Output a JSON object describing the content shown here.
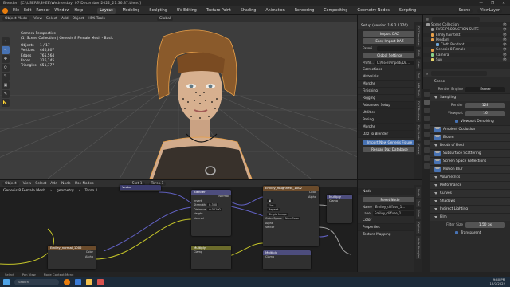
{
  "window": {
    "title": "Blender* [C:\\USERS\\SHEE\\Wednesday, 07-December-2022_21.36.37.blend]",
    "controls": [
      "—",
      "❐",
      "✕"
    ]
  },
  "menubar": {
    "menus": [
      "File",
      "Edit",
      "Render",
      "Window",
      "Help"
    ],
    "workspaces": [
      "Layout",
      "Modeling",
      "Sculpting",
      "UV Editing",
      "Texture Paint",
      "Shading",
      "Animation",
      "Rendering",
      "Compositing",
      "Geometry Nodes",
      "Scripting"
    ],
    "active_workspace": "Layout",
    "scene": "Scene",
    "view_layer": "ViewLayer"
  },
  "viewport": {
    "mode": "Object Mode",
    "menus": [
      "View",
      "Select",
      "Add",
      "Object"
    ],
    "extra": "HPK Tools",
    "orientation": "Global",
    "overlay": {
      "title": "Camera Perspective",
      "collection": "(1) Scene Collection | Genesis 8 Female Mesh - Basic",
      "stats": [
        {
          "label": "Objects",
          "value": "1 / 17"
        },
        {
          "label": "Vertices",
          "value": "440,807"
        },
        {
          "label": "Edges",
          "value": "765,564"
        },
        {
          "label": "Faces",
          "value": "326,145"
        },
        {
          "label": "Triangles",
          "value": "651,777"
        }
      ]
    },
    "tools": [
      "⌖",
      "↖",
      "✥",
      "⟳",
      "⤡",
      "▣",
      "✎",
      "📐"
    ]
  },
  "plugin_panel": {
    "header": "Setup (version 1.6.2.1276)",
    "buttons": [
      "Import DAZ",
      "Easy Import DAZ"
    ],
    "favorites_label": "Favori...",
    "global_settings": "Global Settings",
    "profile_label": "Profil...",
    "profile_path": "C:/Users/mpedi/Do...",
    "sections": [
      "Corrections",
      "Materials",
      "Morphs",
      "Finishing",
      "Rigging"
    ],
    "lower_sections": [
      "Advanced Setup",
      "Utilities",
      "Posing",
      "Morphs",
      "Daz To Blender"
    ],
    "new_genesis_button": "Import New Genesis Figure",
    "scan_button": "Rescan Daz Database",
    "tabs": [
      "DAZ Importer",
      "Edit",
      "View",
      "Tool",
      "HPK Tools",
      "DAZ Runtime",
      "Flip Fluids",
      "Create",
      "Daz Tools",
      "Cam Pose"
    ]
  },
  "outliner": {
    "items": [
      {
        "name": "Scene Collection",
        "indent": 0,
        "color": "#9a9a9a"
      },
      {
        "name": "EVEE PRODUCTION SUITE",
        "indent": 1,
        "color": "#9a9a9a"
      },
      {
        "name": "Emily hair test",
        "indent": 1,
        "color": "#e8a04a"
      },
      {
        "name": "Pendant",
        "indent": 1,
        "color": "#e8a04a"
      },
      {
        "name": "Cloth Pendant",
        "indent": 2,
        "color": "#6fa6d8"
      },
      {
        "name": "Genesis 8 Female",
        "indent": 1,
        "color": "#e8a04a"
      },
      {
        "name": "Camera",
        "indent": 1,
        "color": "#8ad18a"
      },
      {
        "name": "Sun",
        "indent": 1,
        "color": "#e6d46b"
      }
    ]
  },
  "properties": {
    "scene": "Scene",
    "render_engine_label": "Render Engine",
    "render_engine": "Eevee",
    "sampling": "Sampling",
    "render_label": "Render",
    "render_samples": "128",
    "viewport_label": "Viewport",
    "viewport_samples": "16",
    "denoise": "Viewport Denoising",
    "toggles": [
      "Ambient Occlusion",
      "Bloom",
      "Depth of Field",
      "Subsurface Scattering",
      "Screen Space Reflections",
      "Motion Blur",
      "Volumetrics",
      "Performance",
      "Curves",
      "Shadows",
      "Indirect Lighting",
      "Film"
    ],
    "filter_size_label": "Filter Size",
    "filter_size": "1.50 px",
    "transparent": "Transparent"
  },
  "node_editor": {
    "type": "Object",
    "menus": [
      "View",
      "Select",
      "Add",
      "Node"
    ],
    "use_nodes": "Use Nodes",
    "slot": "Slot 1",
    "material": "Torso.1",
    "breadcrumb": [
      "Genesis 8 Female Mesh",
      "geometry",
      "Torso.1"
    ],
    "nodes": {
      "vector": "Vector",
      "blender": "Blender",
      "normal": "Normal",
      "invert": "Invert",
      "strength": "Strength",
      "strength_val": "0.300",
      "distance": "Distance",
      "distance_val": "0.00100",
      "height": "Height",
      "roughness_tex": "Emiley_roughness_1002",
      "color": "Color",
      "alpha": "Alpha",
      "flat": "Flat",
      "repeat": "Repeat",
      "single_image": "Single Image",
      "color_space": "Color Space",
      "non_color": "Non-Color",
      "alpha_label": "Alpha",
      "normal_tex": "Emiley_normal_1002",
      "multiply_label": "Multiply",
      "clamp_label": "Clamp"
    }
  },
  "node_panel": {
    "section": "Node",
    "name_label": "Name",
    "name": "Emiley_diffuse_1...",
    "label_label": "Label",
    "label": "Emiley_diffuse_1...",
    "reset": "Reset Node",
    "color": "Color",
    "properties": "Properties",
    "texture_mapping": "Texture Mapping",
    "tabs": [
      "Node",
      "Tool",
      "View",
      "Options",
      "Node Wrangler"
    ]
  },
  "statusbar": {
    "items": [
      "Select",
      "Pan View",
      "Node Context Menu"
    ]
  },
  "taskbar": {
    "search": "Search",
    "time": "9:40 PM",
    "date": "12/7/2022"
  }
}
